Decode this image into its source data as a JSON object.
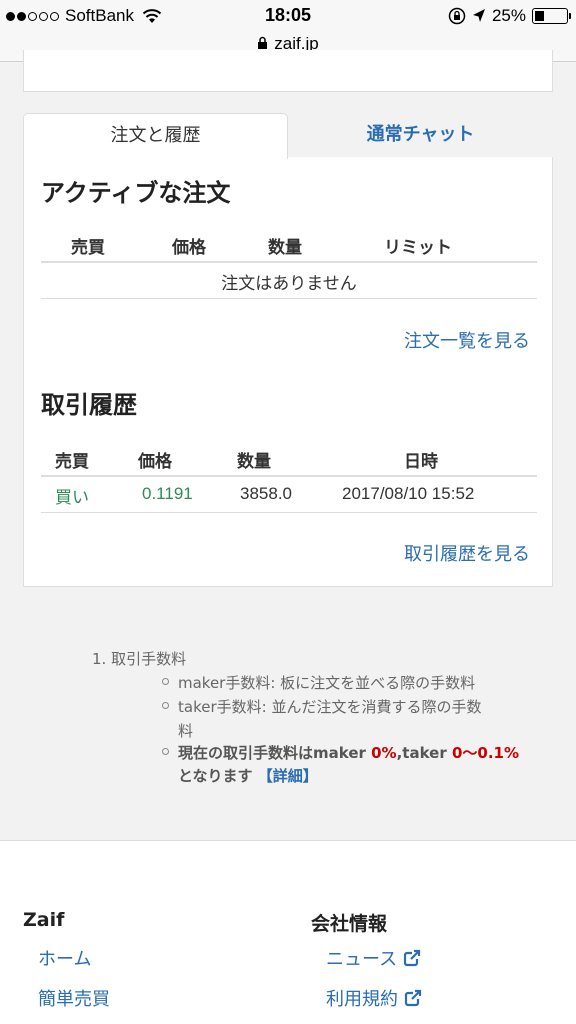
{
  "status": {
    "carrier": "SoftBank",
    "time": "18:05",
    "battery": "25%"
  },
  "url": "zaif.jp",
  "tabs": {
    "orders_history": "注文と履歴",
    "chat": "通常チャット"
  },
  "active_orders": {
    "title": "アクティブな注文",
    "headers": [
      "売買",
      "価格",
      "数量",
      "リミット"
    ],
    "empty": "注文はありません",
    "link": "注文一覧を見る"
  },
  "history": {
    "title": "取引履歴",
    "headers": [
      "売買",
      "価格",
      "数量",
      "日時"
    ],
    "rows": [
      {
        "side": "買い",
        "price": "0.1191",
        "amount": "3858.0",
        "datetime": "2017/08/10 15:52"
      }
    ],
    "link": "取引履歴を見る"
  },
  "notes": {
    "item1": "1.  取引手数料",
    "maker": "maker手数料: 板に注文を並べる際の手数料",
    "taker_line1": "taker手数料: 並んだ注文を消費する際の手数",
    "taker_line2": "料",
    "current_prefix": "現在の取引手数料はmaker ",
    "maker_fee": "0%",
    "mid": ",taker ",
    "taker_fee": "0〜0.1%",
    "line2": "となります ",
    "detail": "【詳細】"
  },
  "footer": {
    "left_title": "Zaif",
    "left_links": [
      "ホーム",
      "簡単売買"
    ],
    "right_title": "会社情報",
    "right_links": [
      "ニュース",
      "利用規約"
    ]
  },
  "colors": {
    "link": "#2a6db0",
    "buy": "#2e8b57",
    "fee": "#cc0000"
  }
}
